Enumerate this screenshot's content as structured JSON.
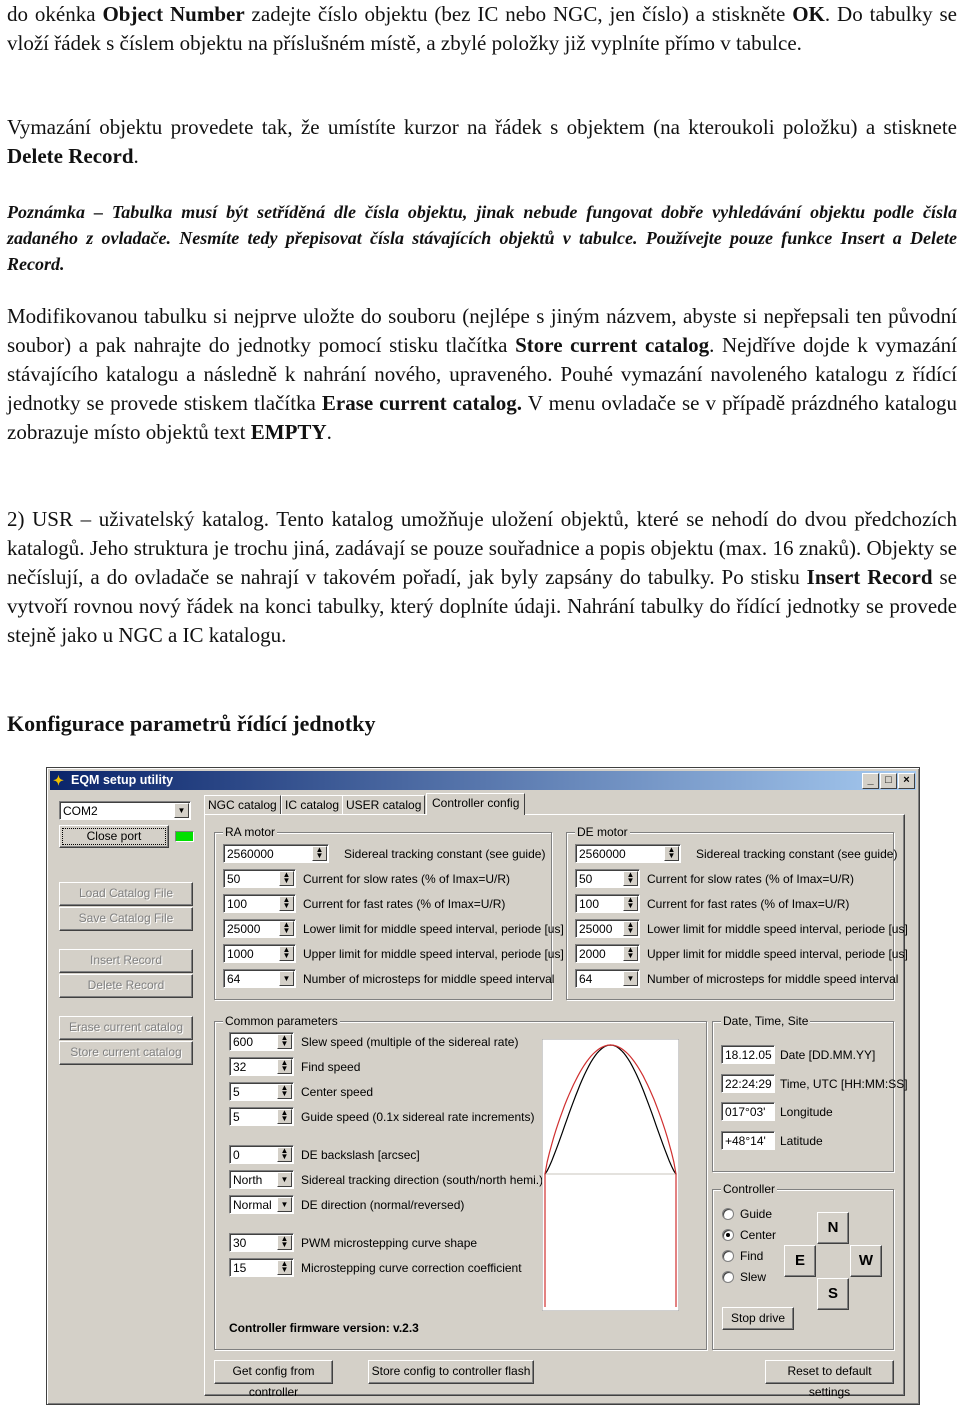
{
  "document": {
    "para1": {
      "t1": "do okénka ",
      "b1": "Object Number",
      "t2": " zadejte číslo objektu (bez IC nebo NGC, jen číslo) a stiskněte ",
      "b2": "OK",
      "t3": ". Do tabulky se vloží řádek s číslem objektu na příslušném místě, a zbylé položky již vyplníte přímo v tabulce."
    },
    "para2": {
      "t1": "Vymazání objektu provedete tak, že umístíte kurzor na řádek s objektem (na kteroukoli položku) a stisknete ",
      "b1": "Delete Record",
      "t2": "."
    },
    "note": "Poznámka – Tabulka musí být setříděná dle čísla objektu, jinak nebude fungovat dobře vyhledávání objektu podle čísla zadaného z ovladače. Nesmíte tedy přepisovat čísla stávajících objektů v tabulce. Používejte pouze funkce Insert a Delete Record.",
    "para3": {
      "t1": "Modifikovanou tabulku si nejprve uložte do souboru (nejlépe s jiným názvem, abyste si nepřepsali ten původní soubor) a pak nahrajte do jednotky pomocí stisku tlačítka ",
      "b1": "Store current catalog",
      "t2": ".  Nejdříve dojde k vymazání stávajícího katalogu a následně k nahrání nového, upraveného. Pouhé vymazání navoleného katalogu z řídící jednotky se provede stiskem tlačítka ",
      "b2": "Erase current catalog.",
      "t3": " V menu ovladače se v případě prázdného katalogu zobrazuje místo objektů text ",
      "b3": "EMPTY",
      "t4": "."
    },
    "para4": {
      "t1": "2) USR – uživatelský katalog. Tento katalog umožňuje uložení objektů, které se nehodí do dvou předchozích katalogů. Jeho struktura je trochu jiná, zadávají se pouze souřadnice a popis objektu (max. 16 znaků). Objekty se nečíslují, a do ovladače se nahrají v takovém pořadí, jak byly zapsány do tabulky. Po stisku ",
      "b1": "Insert Record",
      "t2": " se vytvoří rovnou nový řádek na konci tabulky, který doplníte údaji. Nahrání tabulky do řídící jednotky se provede stejně jako  u NGC a IC katalogu."
    },
    "heading": "Konfigurace parametrů řídící jednotky"
  },
  "window": {
    "title": "EQM setup utility",
    "title_icon": "app-icon",
    "controls": {
      "minimize": "_",
      "maximize": "□",
      "close": "×"
    },
    "left_panel": {
      "port_select": "COM2",
      "close_port": "Close port",
      "status_color": "#00e000",
      "buttons": {
        "load_catalog": "Load Catalog File",
        "save_catalog": "Save Catalog File",
        "insert_record": "Insert Record",
        "delete_record": "Delete Record",
        "erase_catalog": "Erase current catalog",
        "store_catalog": "Store current catalog"
      }
    },
    "tabs": [
      {
        "label": "NGC catalog",
        "active": false
      },
      {
        "label": "IC catalog",
        "active": false
      },
      {
        "label": "USER catalog",
        "active": false
      },
      {
        "label": "Controller config",
        "active": true
      }
    ],
    "ra_motor": {
      "title": "RA motor",
      "rows": [
        {
          "value": "2560000",
          "label": "Sidereal tracking constant (see guide)",
          "control": "spin"
        },
        {
          "value": "50",
          "label": "Current for slow rates (% of Imax=U/R)",
          "control": "spin"
        },
        {
          "value": "100",
          "label": "Current for fast rates (% of Imax=U/R)",
          "control": "spin"
        },
        {
          "value": "25000",
          "label": "Lower limit for  middle speed interval, periode [us]",
          "control": "spin"
        },
        {
          "value": "1000",
          "label": "Upper limit for  middle speed interval, periode [us]",
          "control": "spin"
        },
        {
          "value": "64",
          "label": "Number of microsteps for middle speed interval",
          "control": "dropdown"
        }
      ]
    },
    "de_motor": {
      "title": "DE motor",
      "rows": [
        {
          "value": "2560000",
          "label": "Sidereal tracking constant (see guide)",
          "control": "spin"
        },
        {
          "value": "50",
          "label": "Current for slow rates (% of Imax=U/R)",
          "control": "spin"
        },
        {
          "value": "100",
          "label": "Current for fast rates (% of Imax=U/R)",
          "control": "spin"
        },
        {
          "value": "25000",
          "label": "Lower limit for  middle speed interval, periode [us]",
          "control": "spin"
        },
        {
          "value": "2000",
          "label": "Upper limit for  middle speed interval, periode [us]",
          "control": "spin"
        },
        {
          "value": "64",
          "label": "Number of microsteps for middle speed interval",
          "control": "dropdown"
        }
      ]
    },
    "common": {
      "title": "Common parameters",
      "rows": [
        {
          "value": "600",
          "label": "Slew speed (multiple of the sidereal rate)",
          "control": "spin"
        },
        {
          "value": "32",
          "label": "Find speed",
          "control": "spin"
        },
        {
          "value": "5",
          "label": "Center speed",
          "control": "spin"
        },
        {
          "value": "5",
          "label": "Guide speed (0.1x sidereal rate increments)",
          "control": "spin"
        },
        {
          "value": "0",
          "label": "DE backslash [arcsec]",
          "control": "spin"
        },
        {
          "value": "North",
          "label": "Sidereal tracking direction (south/north hemi.)",
          "control": "dropdown"
        },
        {
          "value": "Normal",
          "label": "DE direction (normal/reversed)",
          "control": "dropdown"
        },
        {
          "value": "30",
          "label": "PWM microstepping curve shape",
          "control": "spin"
        },
        {
          "value": "15",
          "label": "Microstepping curve correction coefficient",
          "control": "spin"
        }
      ],
      "firmware": "Controller firmware version: v.2.3"
    },
    "curve": {
      "black_color": "#000000",
      "red_color": "#d03030"
    },
    "date_time_site": {
      "title": "Date, Time, Site",
      "rows": [
        {
          "value": "18.12.05",
          "label": "Date [DD.MM.YY]"
        },
        {
          "value": "22:24:29",
          "label": "Time, UTC [HH:MM:SS]"
        },
        {
          "value": "017°03'",
          "label": "Longitude"
        },
        {
          "value": "+48°14'",
          "label": "Latitude"
        }
      ]
    },
    "controller": {
      "title": "Controller",
      "modes": [
        {
          "label": "Guide",
          "checked": false
        },
        {
          "label": "Center",
          "checked": true
        },
        {
          "label": "Find",
          "checked": false
        },
        {
          "label": "Slew",
          "checked": false
        }
      ],
      "directions": {
        "n": "N",
        "e": "E",
        "w": "W",
        "s": "S"
      },
      "stop": "Stop drive"
    },
    "bottom_buttons": {
      "get_config": "Get config from controller",
      "store_config": "Store config to controller flash",
      "reset": "Reset to default settings"
    }
  }
}
